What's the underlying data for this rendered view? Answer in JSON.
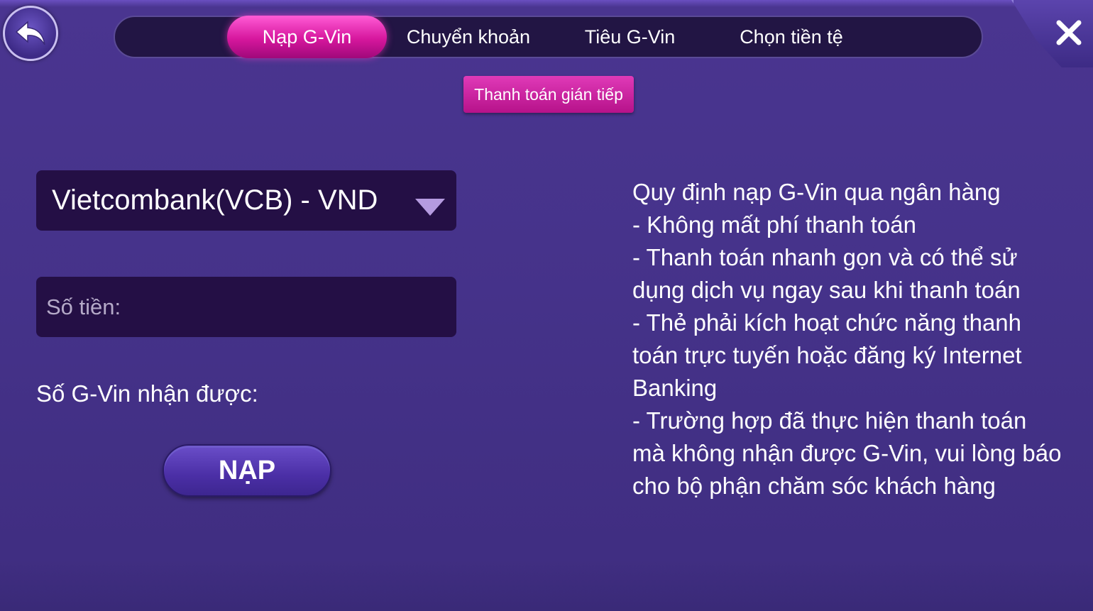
{
  "tabs": [
    {
      "label": "Nạp G-Vin",
      "active": true
    },
    {
      "label": "Chuyển khoản",
      "active": false
    },
    {
      "label": "Tiêu G-Vin",
      "active": false
    },
    {
      "label": "Chọn tiền tệ",
      "active": false
    }
  ],
  "subtab": {
    "label": "Thanh toán gián tiếp"
  },
  "form": {
    "bank_selected": "Vietcombank(VCB) - VND",
    "amount_placeholder": "Số tiền:",
    "receive_label": "Số G-Vin nhận được:",
    "submit_label": "NẠP"
  },
  "rules": {
    "lines": [
      "Quy định nạp G-Vin qua ngân hàng",
      "- Không mất phí thanh toán",
      "- Thanh toán nhanh gọn và có thể sử dụng dịch vụ ngay sau khi thanh toán",
      "- Thẻ phải kích hoạt chức năng thanh toán trực tuyến hoặc đăng ký Internet Banking",
      "- Trường hợp đã thực hiện thanh toán mà không nhận được G-Vin, vui lòng báo cho bộ phận chăm sóc khách hàng"
    ]
  },
  "icons": {
    "back": "back-arrow-icon",
    "close": "close-icon",
    "dropdown": "dropdown-caret-icon"
  },
  "colors": {
    "background": "#46338b",
    "tab_active": "#d6179d",
    "field_bg": "#240f45"
  }
}
